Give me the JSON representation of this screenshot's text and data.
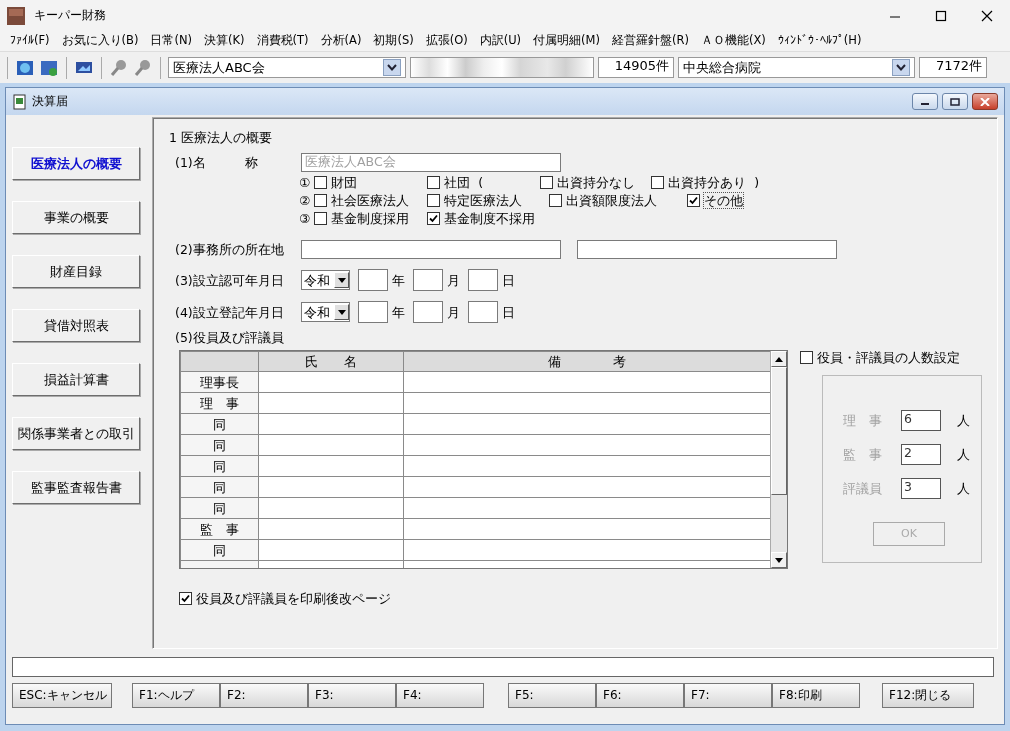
{
  "window": {
    "title": "キーパー財務"
  },
  "menu": [
    "ﾌｧｲﾙ(F)",
    "お気に入り(B)",
    "日常(N)",
    "決算(K)",
    "消費税(T)",
    "分析(A)",
    "初期(S)",
    "拡張(O)",
    "内訳(U)",
    "付属明細(M)",
    "経営羅針盤(R)",
    "ＡＯ機能(X)",
    "ｳｨﾝﾄﾞｳ･ﾍﾙﾌﾟ(H)"
  ],
  "toolbar": {
    "company": "医療法人ABC会",
    "company_count": "14905件",
    "hospital": "中央総合病院",
    "hospital_count": "7172件"
  },
  "document": {
    "title": "決算届"
  },
  "sidebar": [
    {
      "label": "医療法人の概要",
      "selected": true
    },
    {
      "label": "事業の概要",
      "selected": false
    },
    {
      "label": "財産目録",
      "selected": false
    },
    {
      "label": "貸借対照表",
      "selected": false
    },
    {
      "label": "損益計算書",
      "selected": false
    },
    {
      "label": "関係事業者との取引",
      "selected": false
    },
    {
      "label": "監事監査報告書",
      "selected": false
    }
  ],
  "section_title": "1  医療法人の概要",
  "name_field": {
    "label": "(1)名　　　称",
    "value": "医療法人ABC会",
    "disabled": true
  },
  "option_rows": [
    {
      "marker": "①",
      "items": [
        {
          "label": "財団",
          "checked": false
        },
        {
          "label": "社団",
          "checked": false,
          "suffix": "("
        },
        {
          "label": "出資持分なし",
          "checked": false
        },
        {
          "label": "出資持分あり",
          "checked": false,
          "suffix": ")"
        }
      ]
    },
    {
      "marker": "②",
      "items": [
        {
          "label": "社会医療法人",
          "checked": false
        },
        {
          "label": "特定医療法人",
          "checked": false
        },
        {
          "label": "出資額限度法人",
          "checked": false
        },
        {
          "label": "その他",
          "checked": true
        }
      ]
    },
    {
      "marker": "③",
      "items": [
        {
          "label": "基金制度採用",
          "checked": false
        },
        {
          "label": "基金制度不採用",
          "checked": true
        }
      ]
    }
  ],
  "address": {
    "label": "(2)事務所の所在地"
  },
  "dates": [
    {
      "label": "(3)設立認可年月日",
      "era": "令和",
      "units": [
        "年",
        "月",
        "日"
      ]
    },
    {
      "label": "(4)設立登記年月日",
      "era": "令和",
      "units": [
        "年",
        "月",
        "日"
      ]
    }
  ],
  "officers_title": "(5)役員及び評議員",
  "officers_table": {
    "columns": [
      "",
      "氏　　名",
      "備　　　　考"
    ],
    "rows": [
      "理事長",
      "理　事",
      "同",
      "同",
      "同",
      "同",
      "同",
      "監　事",
      "同"
    ]
  },
  "count_setting": {
    "label": "役員・評議員の人数設定",
    "checked": false,
    "disabled": true,
    "rows": [
      {
        "label": "理　事",
        "value": "6",
        "unit": "人"
      },
      {
        "label": "監　事",
        "value": "2",
        "unit": "人"
      },
      {
        "label": "評議員",
        "value": "3",
        "unit": "人"
      }
    ],
    "button": "OK"
  },
  "print_option": {
    "label": "役員及び評議員を印刷後改ページ",
    "checked": true
  },
  "function_keys": [
    [
      "ESC:キャンセル"
    ],
    [
      "F1:ヘルプ",
      "F2:",
      "F3:",
      "F4:"
    ],
    [
      "F5:",
      "F6:",
      "F7:",
      "F8:印刷"
    ],
    [
      "F12:閉じる"
    ]
  ]
}
